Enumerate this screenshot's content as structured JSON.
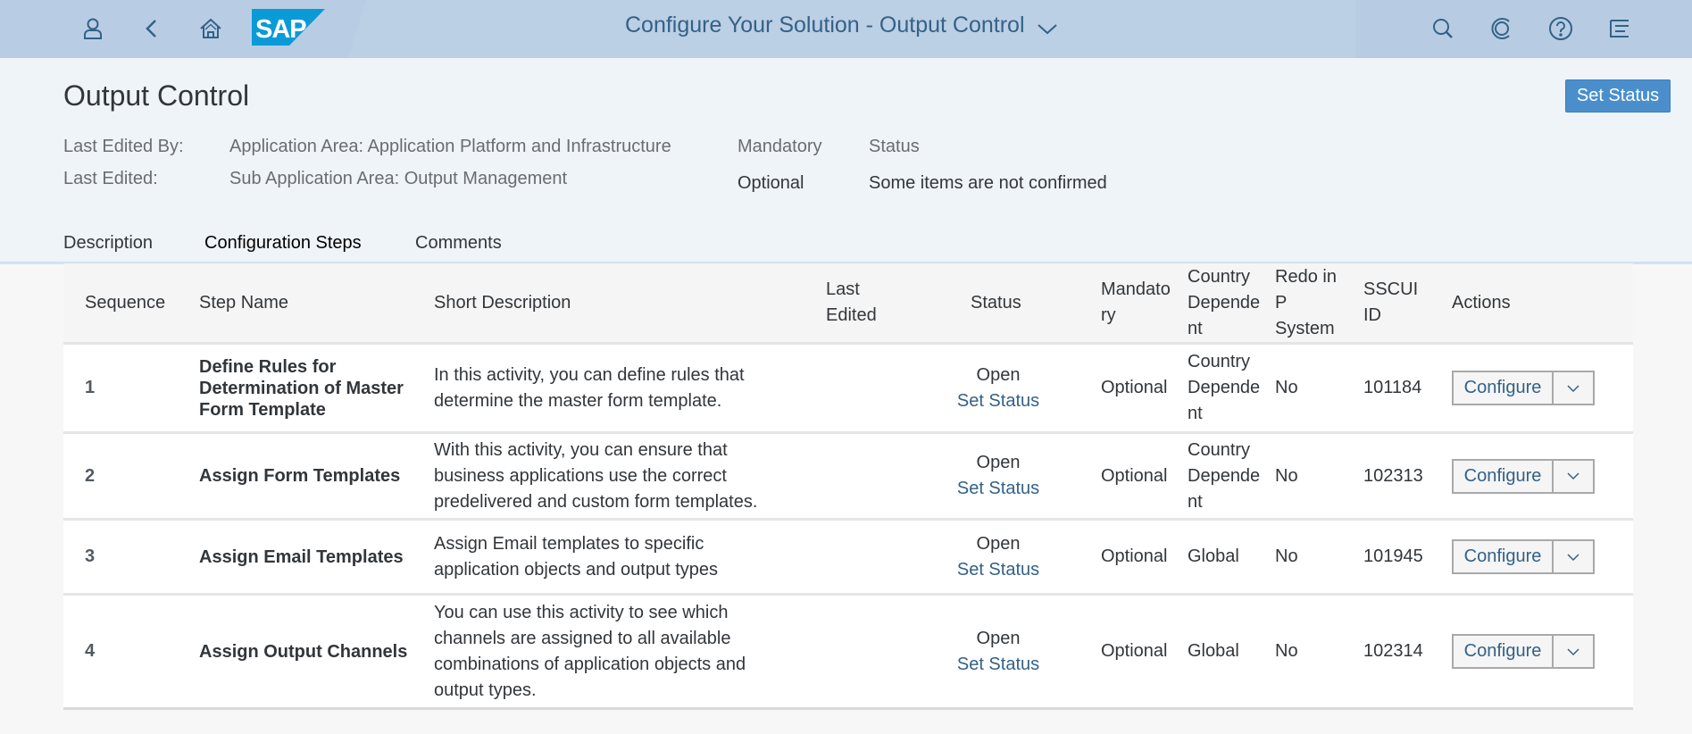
{
  "shell": {
    "title": "Configure Your Solution - Output Control",
    "icons": [
      "user-icon",
      "back-icon",
      "home-icon",
      "sap-logo",
      "search-icon",
      "copilot-icon",
      "help-icon",
      "notifications-icon"
    ],
    "logo_text": "SAP"
  },
  "header": {
    "title": "Output Control",
    "set_status_label": "Set Status",
    "attributes": {
      "last_edited_by_label": "Last Edited By:",
      "last_edited_label": "Last Edited:",
      "application_area": "Application Area: Application Platform and Infrastructure",
      "sub_application_area": "Sub Application Area: Output Management",
      "mandatory_label": "Mandatory",
      "mandatory_value": "Optional",
      "status_label": "Status",
      "status_value": "Some items are not confirmed"
    }
  },
  "tabs": [
    {
      "label": "Description",
      "active": false
    },
    {
      "label": "Configuration Steps",
      "active": true
    },
    {
      "label": "Comments",
      "active": false
    }
  ],
  "table": {
    "columns": {
      "sequence": "Sequence",
      "step_name": "Step Name",
      "short_description": "Short Description",
      "last_edited": "Last Edited",
      "status": "Status",
      "mandatory": "Mandatory",
      "country_dependent": "Country Dependent",
      "redo_in_p_system": "Redo in P System",
      "sscui_id": "SSCUI ID",
      "actions": "Actions"
    },
    "rows": [
      {
        "sequence": "1",
        "step_name": "Define Rules for Determination of Master Form Template",
        "short_description": "In this activity, you can define rules that determine the master form template.",
        "last_edited": "",
        "status": "Open",
        "set_status_label": "Set Status",
        "mandatory": "Optional",
        "country_dependent": "Country Dependent",
        "redo_in_p_system": "No",
        "sscui_id": "101184",
        "action_label": "Configure"
      },
      {
        "sequence": "2",
        "step_name": "Assign Form Templates",
        "short_description": "With this activity, you can ensure that business applications use the correct predelivered and custom form templates.",
        "last_edited": "",
        "status": "Open",
        "set_status_label": "Set Status",
        "mandatory": "Optional",
        "country_dependent": "Country Dependent",
        "redo_in_p_system": "No",
        "sscui_id": "102313",
        "action_label": "Configure"
      },
      {
        "sequence": "3",
        "step_name": "Assign Email Templates",
        "short_description": "Assign Email templates to specific application objects and output types",
        "last_edited": "",
        "status": "Open",
        "set_status_label": "Set Status",
        "mandatory": "Optional",
        "country_dependent": "Global",
        "redo_in_p_system": "No",
        "sscui_id": "101945",
        "action_label": "Configure"
      },
      {
        "sequence": "4",
        "step_name": "Assign Output Channels",
        "short_description": "You can use this activity to see which channels are assigned to all available combinations of application objects and output types.",
        "last_edited": "",
        "status": "Open",
        "set_status_label": "Set Status",
        "mandatory": "Optional",
        "country_dependent": "Global",
        "redo_in_p_system": "No",
        "sscui_id": "102314",
        "action_label": "Configure"
      }
    ]
  },
  "colors": {
    "shell_bg": "#bbcfe5",
    "header_bg": "#eff4f9",
    "accent": "#346187",
    "button_bg": "#4a8fcc",
    "tab_underline": "#3f7bab"
  }
}
